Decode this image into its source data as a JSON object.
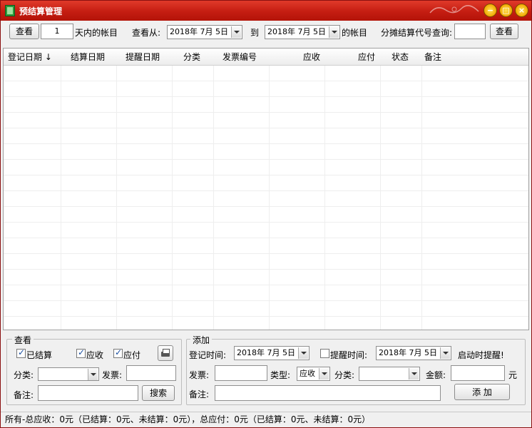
{
  "window": {
    "title": "预结算管理"
  },
  "toolbar": {
    "view_button": "查看",
    "days_value": "1",
    "days_suffix": "天内的帐目",
    "from_label": "查看从:",
    "from_date": "2018年 7月 5日",
    "to_label": "到",
    "to_date": "2018年 7月 5日",
    "to_suffix": "的帐目",
    "split_query_label": "分摊结算代号查询:",
    "split_query_value": "",
    "split_view_button": "查看"
  },
  "table": {
    "columns": [
      "登记日期 ↓",
      "结算日期",
      "提醒日期",
      "分类",
      "发票编号",
      "应收",
      "应付",
      "状态",
      "备注"
    ],
    "rows": []
  },
  "view_panel": {
    "title": "查看",
    "settled_label": "已结算",
    "settled_checked": true,
    "receivable_label": "应收",
    "receivable_checked": true,
    "payable_label": "应付",
    "payable_checked": true,
    "category_label": "分类:",
    "category_value": "",
    "invoice_label": "发票:",
    "invoice_value": "",
    "note_label": "备注:",
    "note_value": "",
    "search_button": "搜索"
  },
  "add_panel": {
    "title": "添加",
    "reg_time_label": "登记时间:",
    "reg_date": "2018年 7月 5日",
    "remind_time_label": "提醒时间:",
    "remind_checked": false,
    "remind_date": "2018年 7月 5日",
    "start_remind_label": "启动时提醒!",
    "invoice_label": "发票:",
    "invoice_value": "",
    "type_label": "类型:",
    "type_value": "应收",
    "category_label": "分类:",
    "category_value": "",
    "amount_label": "金额:",
    "amount_value": "",
    "amount_unit": "元",
    "note_label": "备注:",
    "note_value": "",
    "add_button": "添 加"
  },
  "status": {
    "text": "所有-总应收：0元（已结算：0元、未结算：0元），总应付：0元（已结算：0元、未结算：0元）"
  },
  "colors": {
    "titlebar": "#c51d12",
    "accent": "#f1a900"
  }
}
